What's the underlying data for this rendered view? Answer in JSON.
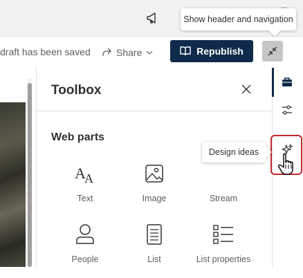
{
  "topbar": {
    "tooltip": "Show header and navigation",
    "megaphone_icon": "megaphone-icon"
  },
  "commandbar": {
    "draft_status": "draft has been saved",
    "share_label": "Share",
    "republish_label": "Republish",
    "collapse_icon": "collapse-arrows-icon"
  },
  "toolbox": {
    "title": "Toolbox",
    "section_title": "Web parts",
    "items": [
      {
        "label": "Text",
        "icon": "text-icon"
      },
      {
        "label": "Image",
        "icon": "image-icon"
      },
      {
        "label": "Stream",
        "icon": "stream-icon"
      },
      {
        "label": "People",
        "icon": "people-icon"
      },
      {
        "label": "List",
        "icon": "list-icon"
      },
      {
        "label": "List properties",
        "icon": "list-properties-icon"
      }
    ]
  },
  "rail": {
    "design_ideas_tooltip": "Design ideas",
    "buttons": [
      "toolbox-icon",
      "settings-sliders-icon",
      "design-ideas-icon"
    ]
  },
  "colors": {
    "brand_navy": "#0f2a4a",
    "highlight_red": "#c0282e",
    "neutral_bar": "#f3f2f1"
  }
}
